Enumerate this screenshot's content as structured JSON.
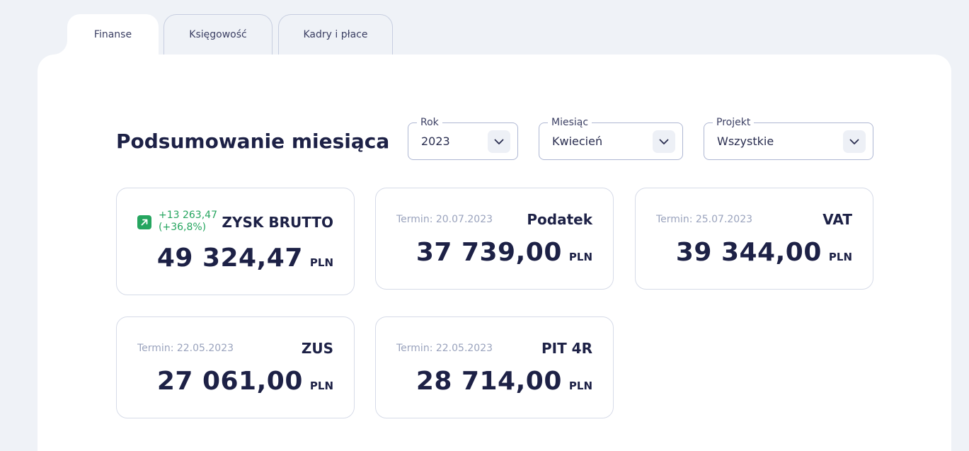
{
  "tabs": [
    {
      "label": "Finanse",
      "active": true
    },
    {
      "label": "Księgowość",
      "active": false
    },
    {
      "label": "Kadry i płace",
      "active": false
    }
  ],
  "page_title": "Podsumowanie miesiąca",
  "filters": {
    "rok": {
      "label": "Rok",
      "value": "2023"
    },
    "miesiac": {
      "label": "Miesiąc",
      "value": "Kwiecień"
    },
    "projekt": {
      "label": "Projekt",
      "value": "Wszystkie"
    }
  },
  "cards": {
    "zysk": {
      "label": "ZYSK BRUTTO",
      "change_value": "+13 263,47",
      "change_percent": "(+36,8%)",
      "amount": "49 324,47",
      "currency": "PLN"
    },
    "podatek": {
      "label": "Podatek",
      "term": "Termin: 20.07.2023",
      "amount": "37 739,00",
      "currency": "PLN"
    },
    "vat": {
      "label": "VAT",
      "term": "Termin: 25.07.2023",
      "amount": "39 344,00",
      "currency": "PLN"
    },
    "zus": {
      "label": "ZUS",
      "term": "Termin: 22.05.2023",
      "amount": "27 061,00",
      "currency": "PLN"
    },
    "pit": {
      "label": "PIT 4R",
      "term": "Termin: 22.05.2023",
      "amount": "28 714,00",
      "currency": "PLN"
    }
  },
  "colors": {
    "background": "#eff2f7",
    "text": "#1d2146",
    "positive": "#25a55f",
    "muted": "#9aa3bd"
  },
  "icons": {
    "dropdown": "chevron-down-icon",
    "trend": "arrow-up-right-icon"
  }
}
